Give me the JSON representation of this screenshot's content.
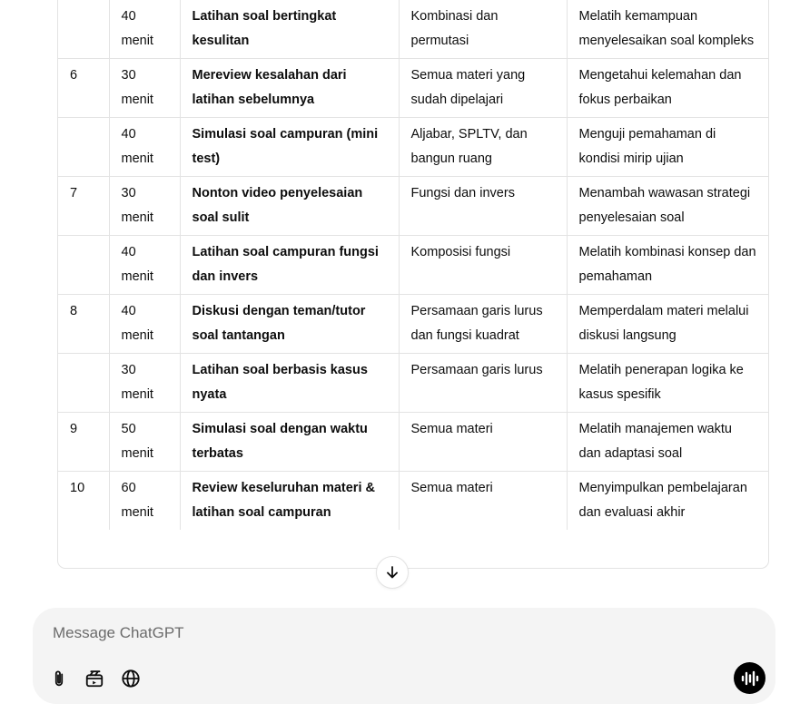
{
  "table": {
    "rows": [
      {
        "day": "",
        "duration": "",
        "activity": "",
        "topic": "",
        "goal": ""
      },
      {
        "day": "",
        "duration": "40 menit",
        "activity": "Latihan soal bertingkat kesulitan",
        "topic": "Kombinasi dan permutasi",
        "goal": "Melatih kemampuan menyelesaikan soal kompleks"
      },
      {
        "day": "6",
        "duration": "30 menit",
        "activity": "Mereview kesalahan dari latihan sebelumnya",
        "topic": "Semua materi yang sudah dipelajari",
        "goal": "Mengetahui kelemahan dan fokus perbaikan"
      },
      {
        "day": "",
        "duration": "40 menit",
        "activity": "Simulasi soal campuran (mini test)",
        "topic": "Aljabar, SPLTV, dan bangun ruang",
        "goal": "Menguji pemahaman di kondisi mirip ujian"
      },
      {
        "day": "7",
        "duration": "30 menit",
        "activity": "Nonton video penyelesaian soal sulit",
        "topic": "Fungsi dan invers",
        "goal": "Menambah wawasan strategi penyelesaian soal"
      },
      {
        "day": "",
        "duration": "40 menit",
        "activity": "Latihan soal campuran fungsi dan invers",
        "topic": "Komposisi fungsi",
        "goal": "Melatih kombinasi konsep dan pemahaman"
      },
      {
        "day": "8",
        "duration": "40 menit",
        "activity": "Diskusi dengan teman/tutor soal tantangan",
        "topic": "Persamaan garis lurus dan fungsi kuadrat",
        "goal": "Memperdalam materi melalui diskusi langsung"
      },
      {
        "day": "",
        "duration": "30 menit",
        "activity": "Latihan soal berbasis kasus nyata",
        "topic": "Persamaan garis lurus",
        "goal": "Melatih penerapan logika ke kasus spesifik"
      },
      {
        "day": "9",
        "duration": "50 menit",
        "activity": "Simulasi soal dengan waktu terbatas",
        "topic": "Semua materi",
        "goal": "Melatih manajemen waktu dan adaptasi soal"
      },
      {
        "day": "10",
        "duration": "60 menit",
        "activity": "Review keseluruhan materi & latihan soal campuran",
        "topic": "Semua materi",
        "goal": "Menyimpulkan pembelajaran dan evaluasi akhir"
      }
    ]
  },
  "composer": {
    "placeholder": "Message ChatGPT",
    "icons": [
      "paperclip-icon",
      "tools-icon",
      "globe-icon",
      "voice-icon",
      "arrow-down-icon"
    ]
  }
}
